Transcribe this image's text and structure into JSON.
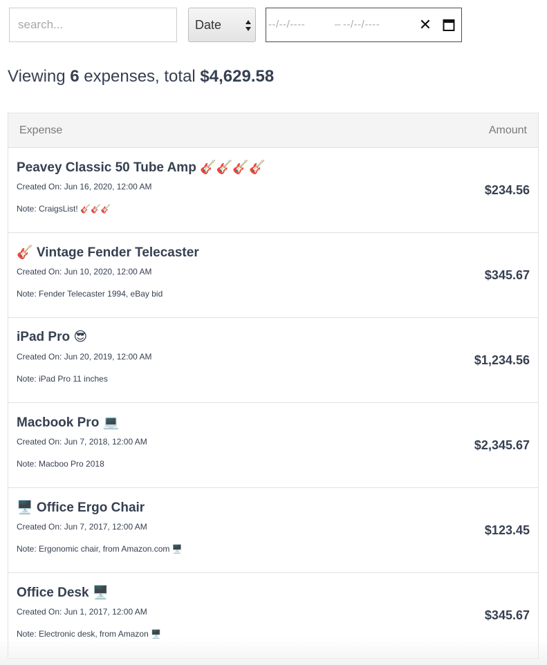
{
  "filters": {
    "search_placeholder": "search...",
    "sort_value": "Date",
    "date_start_placeholder": "--/--/----",
    "date_separator": "–",
    "date_end_placeholder": "--/--/----",
    "clear_glyph": "✕"
  },
  "summary": {
    "prefix": "Viewing ",
    "count": "6",
    "middle": " expenses, total ",
    "total": "$4,629.58"
  },
  "table": {
    "header_expense": "Expense",
    "header_amount": "Amount",
    "rows": [
      {
        "title": "Peavey Classic 50 Tube Amp 🎸🎸🎸🎸",
        "created": "Created On: Jun 16, 2020, 12:00 AM",
        "note": "Note: CraigsList! 🎸🎸🎸",
        "amount": "$234.56"
      },
      {
        "title": "🎸 Vintage Fender Telecaster",
        "created": "Created On: Jun 10, 2020, 12:00 AM",
        "note": "Note: Fender Telecaster 1994, eBay bid",
        "amount": "$345.67"
      },
      {
        "title": "iPad Pro 😎",
        "created": "Created On: Jun 20, 2019, 12:00 AM",
        "note": "Note: iPad Pro 11 inches",
        "amount": "$1,234.56"
      },
      {
        "title": "Macbook Pro 💻",
        "created": "Created On: Jun 7, 2018, 12:00 AM",
        "note": "Note: Macboo Pro 2018",
        "amount": "$2,345.67"
      },
      {
        "title": "🖥️ Office Ergo Chair",
        "created": "Created On: Jun 7, 2017, 12:00 AM",
        "note": "Note: Ergonomic chair, from Amazon.com 🖥️",
        "amount": "$123.45"
      },
      {
        "title": "Office Desk 🖥️",
        "created": "Created On: Jun 1, 2017, 12:00 AM",
        "note": "Note: Electronic desk, from Amazon 🖥️",
        "amount": "$345.67"
      }
    ]
  }
}
